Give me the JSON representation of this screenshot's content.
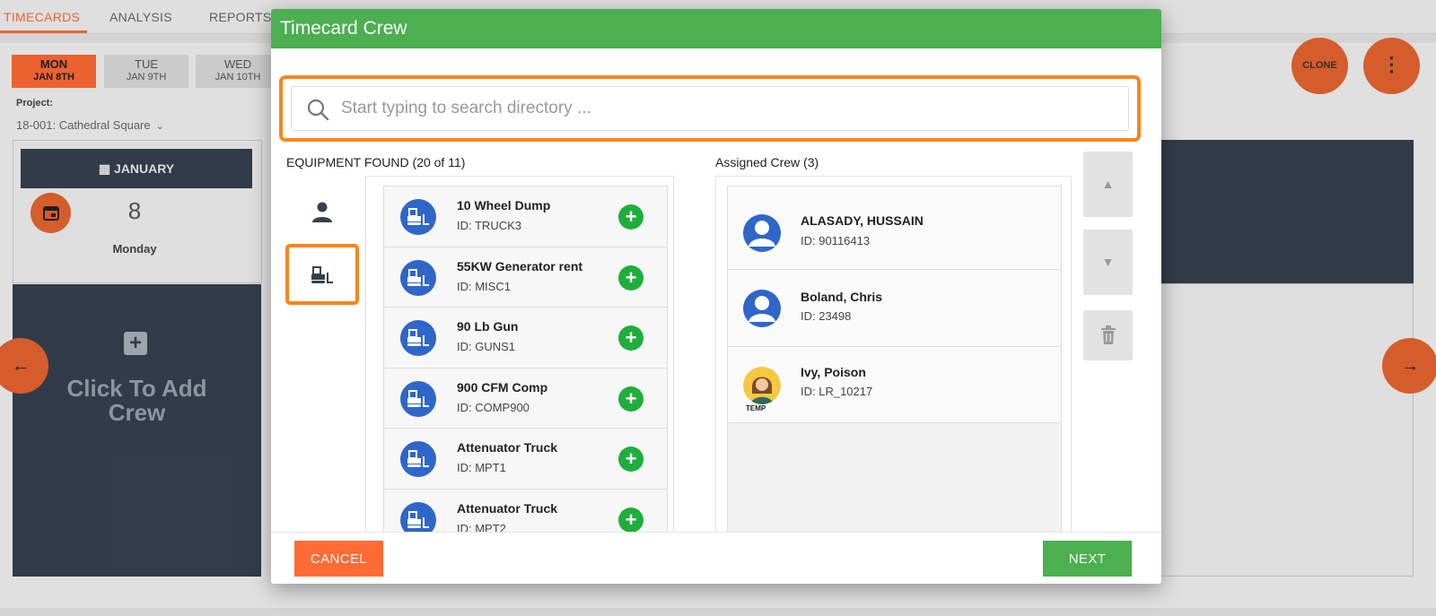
{
  "topnav": {
    "tabs": [
      {
        "label": "TIMECARDS",
        "active": true
      },
      {
        "label": "ANALYSIS",
        "active": false
      },
      {
        "label": "REPORTS",
        "active": false
      }
    ]
  },
  "days": [
    {
      "dow": "MON",
      "date": "JAN 8TH",
      "active": true
    },
    {
      "dow": "TUE",
      "date": "JAN 9TH",
      "active": false
    },
    {
      "dow": "WED",
      "date": "JAN 10TH",
      "active": false
    }
  ],
  "project": {
    "label": "Project:",
    "value": "18-001: Cathedral Square"
  },
  "calendar": {
    "month": "JANUARY",
    "day": "8",
    "weekday": "Monday"
  },
  "add_crew": {
    "line1": "Click To Add",
    "line2": "Crew"
  },
  "actions": {
    "clone_label": "CLONE"
  },
  "modal": {
    "title": "Timecard Crew",
    "search_placeholder": "Start typing to search directory ...",
    "equipment_title": "EQUIPMENT FOUND (20 of 11)",
    "crew_title": "Assigned Crew (3)",
    "equipment": [
      {
        "name": "10 Wheel Dump",
        "id": "ID: TRUCK3"
      },
      {
        "name": "55KW Generator rent",
        "id": "ID: MISC1"
      },
      {
        "name": "90 Lb Gun",
        "id": "ID: GUNS1"
      },
      {
        "name": "900 CFM Comp",
        "id": "ID: COMP900"
      },
      {
        "name": "Attenuator Truck",
        "id": "ID: MPT1"
      },
      {
        "name": "Attenuator Truck",
        "id": "ID: MPT2"
      }
    ],
    "crew": [
      {
        "name": "ALASADY, HUSSAIN",
        "id": "ID: 90116413",
        "temp": false
      },
      {
        "name": "Boland, Chris",
        "id": "ID: 23498",
        "temp": false
      },
      {
        "name": "Ivy, Poison",
        "id": "ID: LR_10217",
        "temp": true,
        "badge": "TEMP"
      }
    ],
    "cancel_label": "CANCEL",
    "next_label": "NEXT"
  },
  "colors": {
    "accent_orange": "#ff6b35",
    "header_green": "#4caf50",
    "add_green": "#1fae3c",
    "avatar_blue": "#2f66c9",
    "dark_slate": "#364150",
    "highlight_orange": "#f7861e"
  }
}
